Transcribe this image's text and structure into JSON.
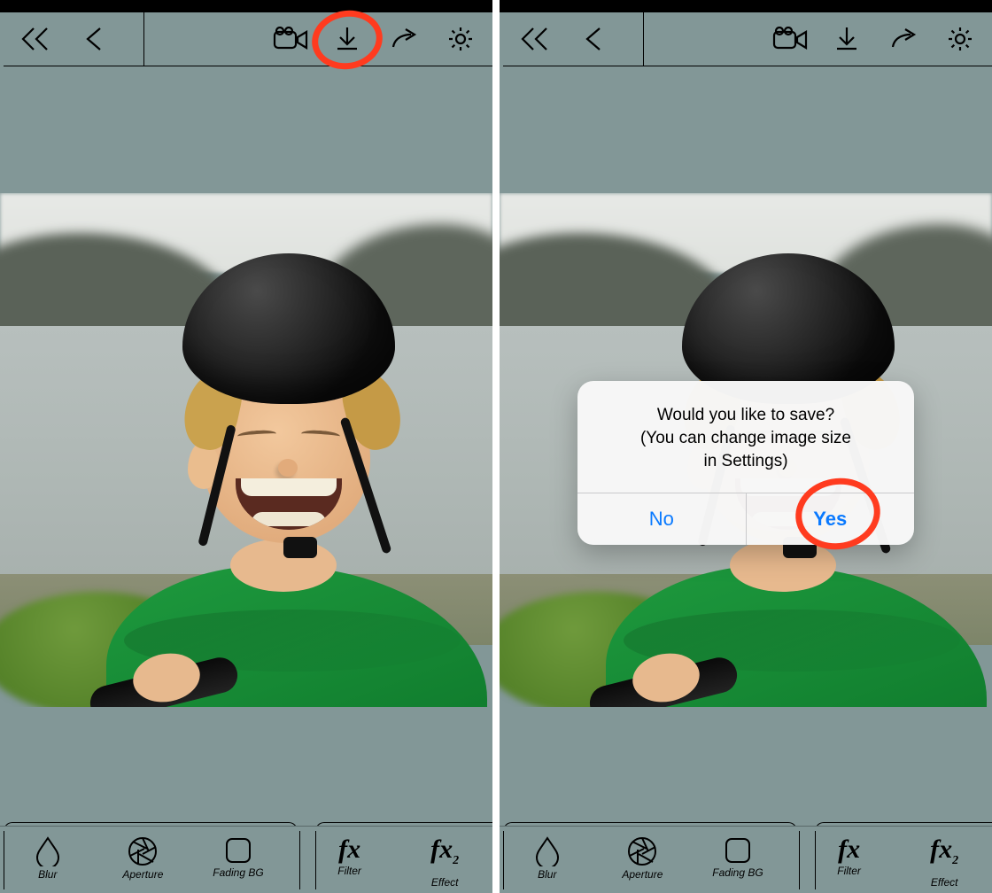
{
  "icons": {
    "back_all": "chevron-double-left-icon",
    "back": "chevron-left-icon",
    "camera": "video-camera-icon",
    "download": "download-icon",
    "share": "share-arrow-icon",
    "settings": "gear-icon"
  },
  "bottom_tools": [
    {
      "id": "blur",
      "label": "Blur",
      "icon": "droplet-icon"
    },
    {
      "id": "aperture",
      "label": "Aperture",
      "icon": "aperture-icon"
    },
    {
      "id": "fading_bg",
      "label": "Fading BG",
      "icon": "rounded-square-icon"
    },
    {
      "id": "filter",
      "label": "Filter",
      "glyph": "fx"
    },
    {
      "id": "effect",
      "label": "Effect",
      "glyph": "fx",
      "sub": "2"
    }
  ],
  "alert": {
    "line1": "Would you like to save?",
    "line2": "(You can change image size",
    "line3": "in Settings)",
    "no": "No",
    "yes": "Yes"
  },
  "annotations": {
    "left_circle_target": "download-button",
    "right_circle_target": "alert-yes-button"
  },
  "colors": {
    "app_bg": "#829797",
    "ios_blue": "#0a7aff",
    "annotation_red": "#ff3b1f",
    "shirt_green": "#1e9a3e"
  }
}
